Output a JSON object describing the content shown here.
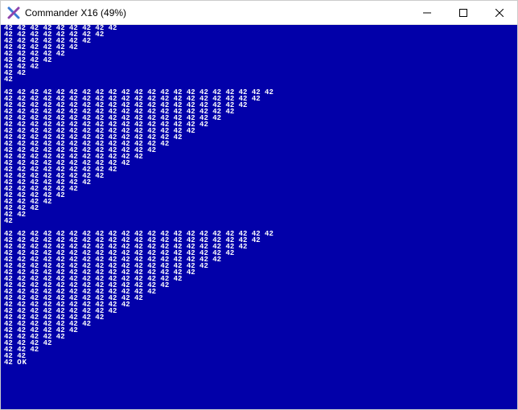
{
  "window": {
    "title": "Commander X16 (49%)",
    "icon_name": "commander-x16-logo"
  },
  "controls": {
    "minimize_label": "Minimize",
    "maximize_label": "Maximize",
    "close_label": "Close"
  },
  "colors": {
    "bg": "#0200a9",
    "fg": "#ffffff"
  },
  "terminal": {
    "token": "42",
    "ok": "OK",
    "blocks": [
      {
        "start_count": 9,
        "end_count": 1,
        "gap_after": 1
      },
      {
        "start_count": 21,
        "end_count": 1,
        "gap_after": 1
      },
      {
        "start_count": 21,
        "end_count": 2,
        "gap_after": 0,
        "suffix_ok": true
      }
    ]
  }
}
